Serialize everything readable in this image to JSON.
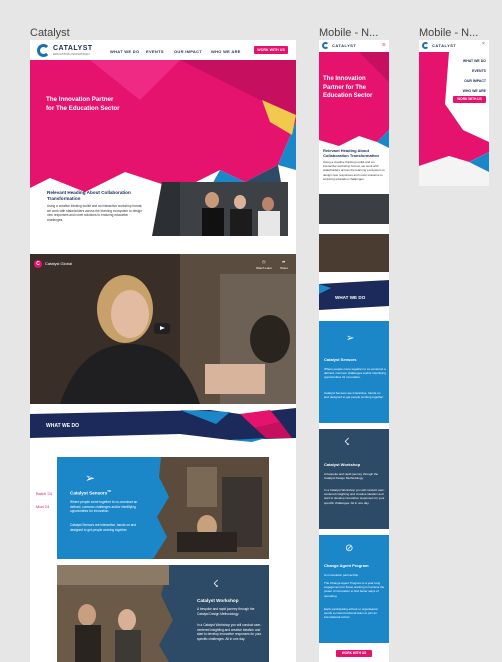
{
  "frames": {
    "desktop_label": "Catalyst",
    "mobile1_label": "Mobile - N...",
    "mobile2_label": "Mobile - N..."
  },
  "brand": {
    "name": "CATALYST",
    "tagline": "EDUCATION INNOVATION"
  },
  "nav": {
    "items": [
      "WHAT WE DO",
      "EVENTS",
      "OUR IMPACT",
      "WHO WE ARE"
    ],
    "cta": "WORK WITH US"
  },
  "hero": {
    "title_line1": "The Innovation Partner",
    "title_line2": "for The Education Sector"
  },
  "relevant": {
    "heading_line1": "Relevant Heading About Collaboration",
    "heading_line2": "Transformation",
    "body": "Using a creative thinking toolkit and an interactive workshop format, we work with stakeholders across the learning ecosystem to design new responses and novel solutions to enduring education challenges."
  },
  "video": {
    "channel": "Catalyst Global",
    "watch_later": "Watch Later",
    "share": "Share"
  },
  "what_we_do": {
    "title": "WHAT WE DO"
  },
  "dates": {
    "first": "Batch 24",
    "second": "Mod 24"
  },
  "sensemaker": {
    "title": "Catalyst Sensors",
    "tm": "TM",
    "body1": "Where people come together to co-construct an defined, common challenges and/or identifying opportunities for innovation.",
    "body2": "Catalyst Sensors are interactive, hands on and designed to get people working together."
  },
  "workshop": {
    "title": "Catalyst Workshop",
    "intro": "A bespoke and rapid journey through the Catalyst Design Methodology.",
    "body": "In a Catalyst Workshop you will conduct user-centered insighting and creative ideation and start to develop innovative responses for your specific challenges. All in one day."
  },
  "mobile": {
    "hero_line1": "The Innovation",
    "hero_line2": "Partner for The",
    "hero_line3": "Education Sector",
    "heading_line1": "Relevant Heading About",
    "heading_line2": "Collaboration Transformation",
    "body": "Using a creative thinking toolkit and an interactive workshop format, we work with stakeholders across the learning ecosystem to design new responses and novel solutions to enduring education challenges.",
    "what_we_do": "WHAT WE DO",
    "sensors_title": "Catalyst Sensors",
    "sensors_body1": "Where people come together to co-construct a defined, common challenges and/or identifying opportunities for innovation.",
    "sensors_body2": "Catalyst Sensors are interactive, hands on and designed to get people working together.",
    "workshop_title": "Catalyst Workshop",
    "workshop_body1": "A bespoke and rapid journey through the Catalyst Design Methodology.",
    "workshop_body2": "In a Catalyst Workshop you will conduct user-centered insighting and creative ideation and start to develop innovative responses for your specific challenges. All in one day.",
    "agent_title": "Change Agent Program",
    "agent_intro": "An innovation partnership.",
    "agent_body1": "The Change Agent Program is a year long engagement for those wanting to harness the power of innovation to find better ways of operating.",
    "agent_body2": "Each participating school or organisation sends a cross-functional team to join an international cohort.",
    "cta": "WORK WITH US"
  },
  "mobile_menu": {
    "items": [
      "WHAT WE DO",
      "EVENTS",
      "OUR IMPACT",
      "WHO WE ARE"
    ],
    "cta": "WORK WITH US"
  },
  "colors": {
    "pink": "#e5136e",
    "blue": "#1b87c9",
    "navy": "#1b2a5a",
    "slate": "#2d4a66"
  }
}
